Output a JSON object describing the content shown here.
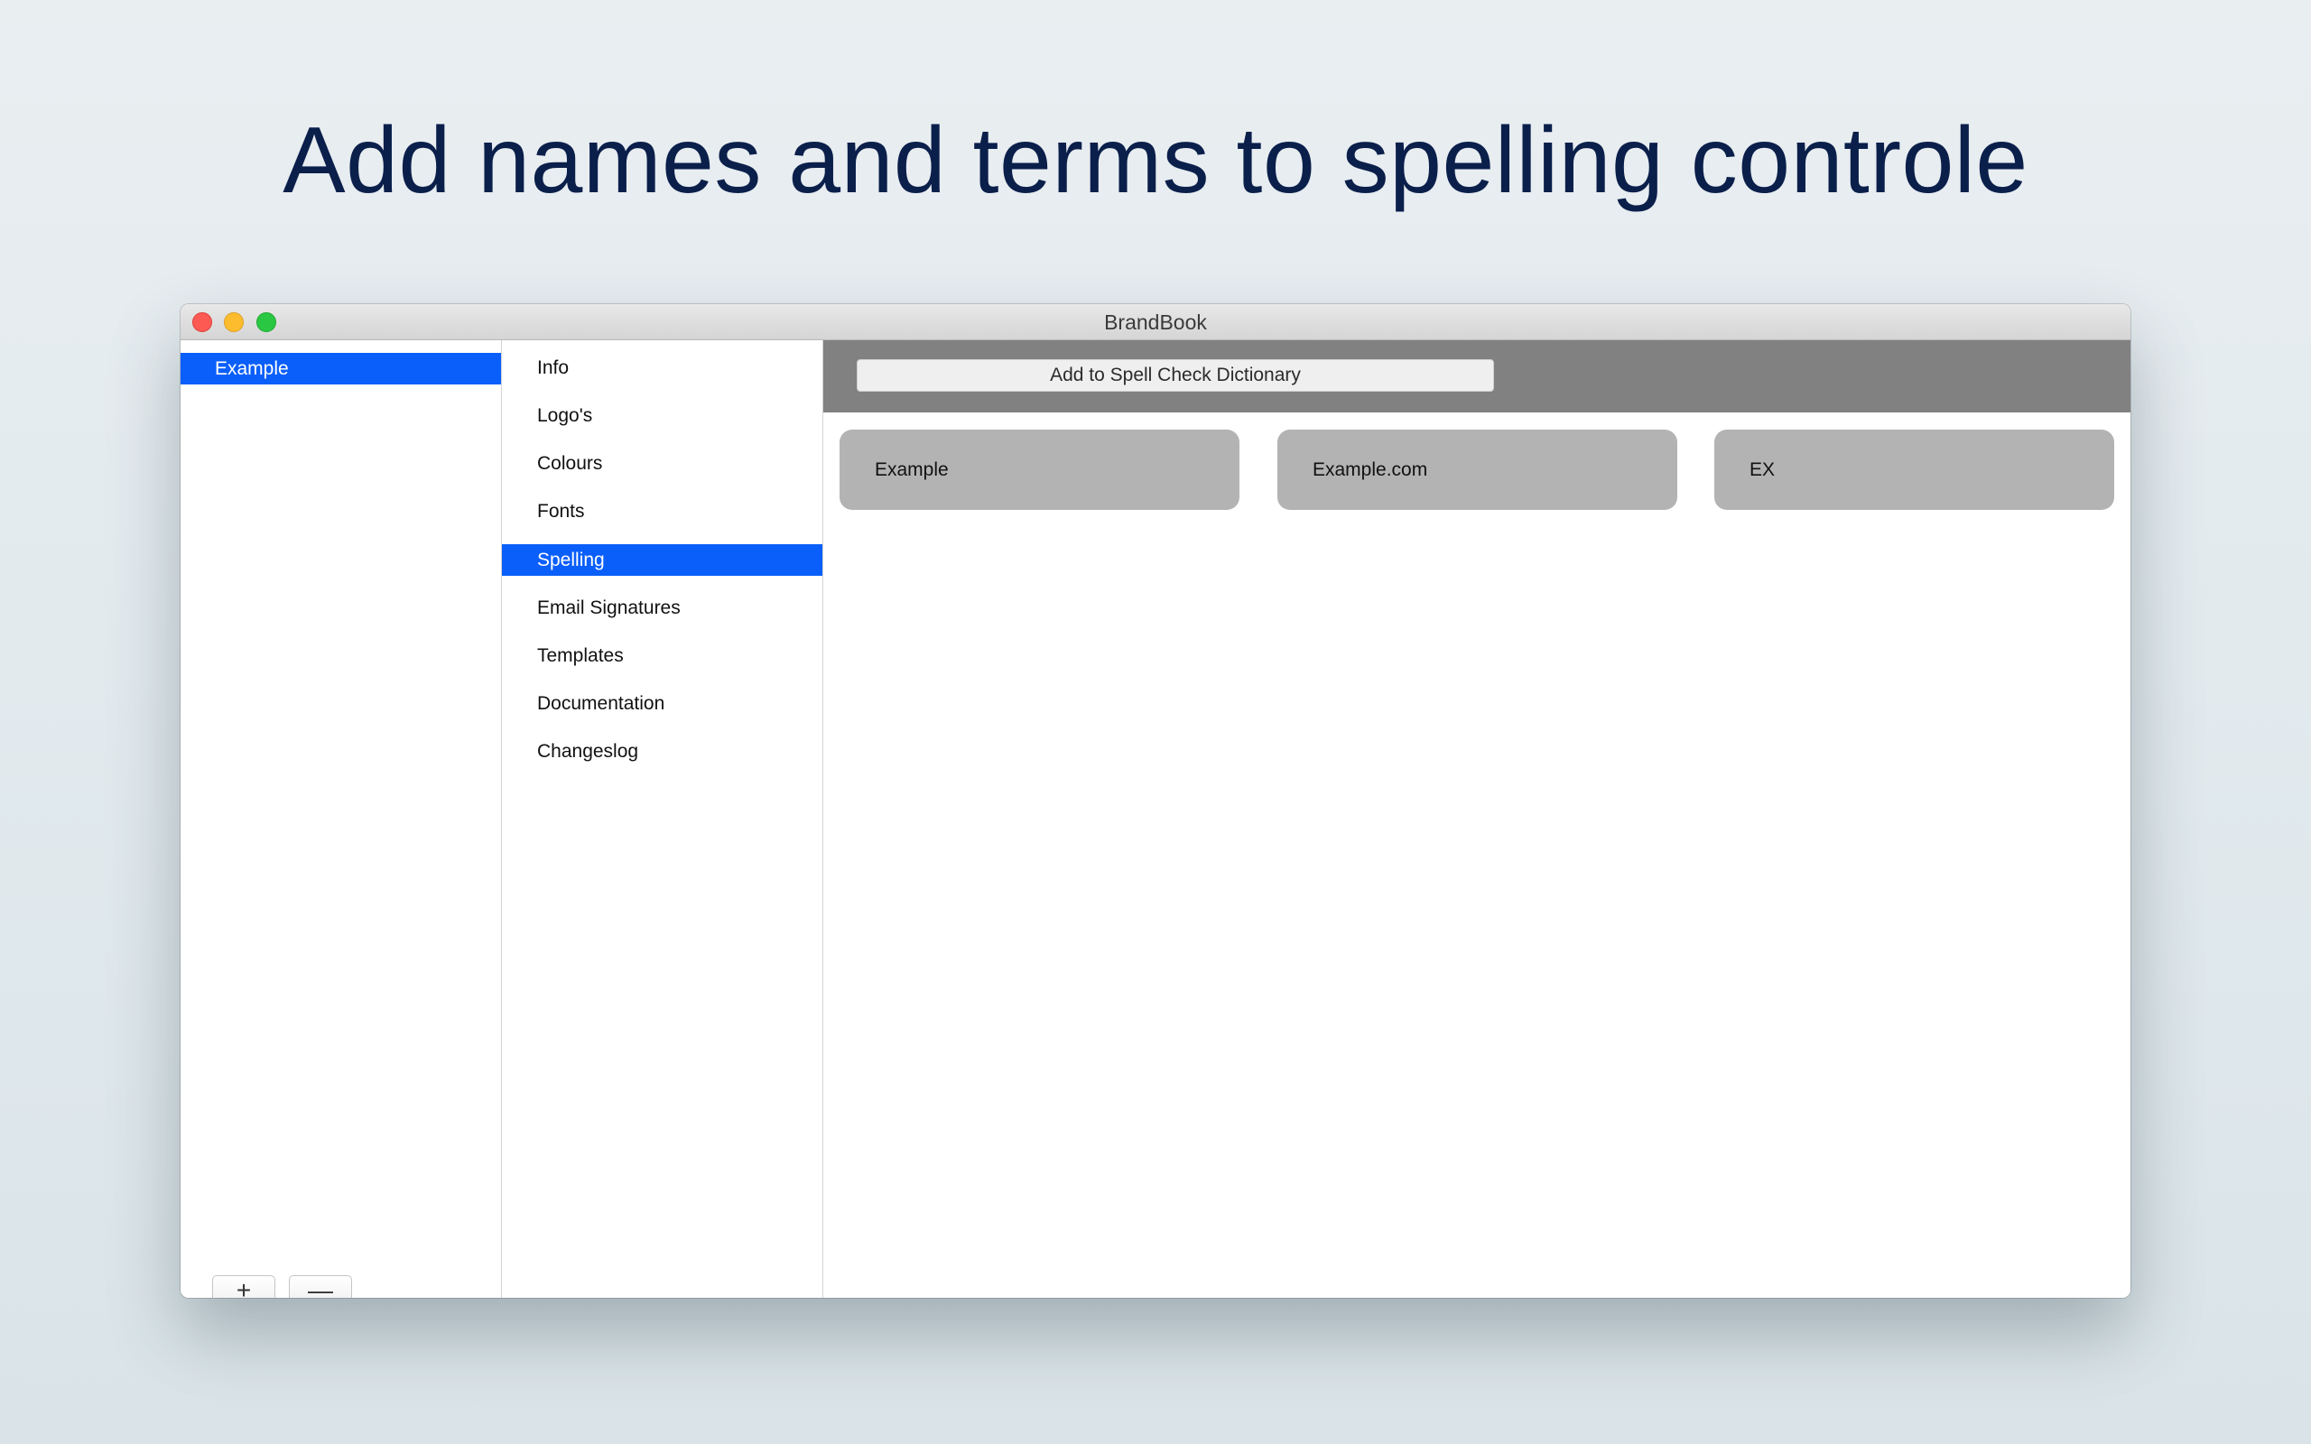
{
  "headline": "Add names and terms to spelling controle",
  "window": {
    "title": "BrandBook",
    "controls": {
      "close": "close-icon",
      "minimize": "minimize-icon",
      "maximize": "maximize-icon"
    }
  },
  "brands": {
    "items": [
      {
        "label": "Example",
        "selected": true
      }
    ],
    "add_label": "+",
    "remove_label": "—"
  },
  "sections": {
    "items": [
      {
        "label": "Info",
        "selected": false
      },
      {
        "label": "Logo's",
        "selected": false
      },
      {
        "label": "Colours",
        "selected": false
      },
      {
        "label": "Fonts",
        "selected": false
      },
      {
        "label": "Spelling",
        "selected": true
      },
      {
        "label": "Email Signatures",
        "selected": false
      },
      {
        "label": "Templates",
        "selected": false
      },
      {
        "label": "Documentation",
        "selected": false
      },
      {
        "label": "Changeslog",
        "selected": false
      }
    ]
  },
  "spelling": {
    "add_button_label": "Add to Spell Check Dictionary",
    "terms": [
      "Example",
      "Example.com",
      "EX"
    ]
  },
  "colors": {
    "selection": "#0a5ffb",
    "toolbar": "#818181",
    "card": "#b3b3b3",
    "headline": "#0b1f4b"
  }
}
